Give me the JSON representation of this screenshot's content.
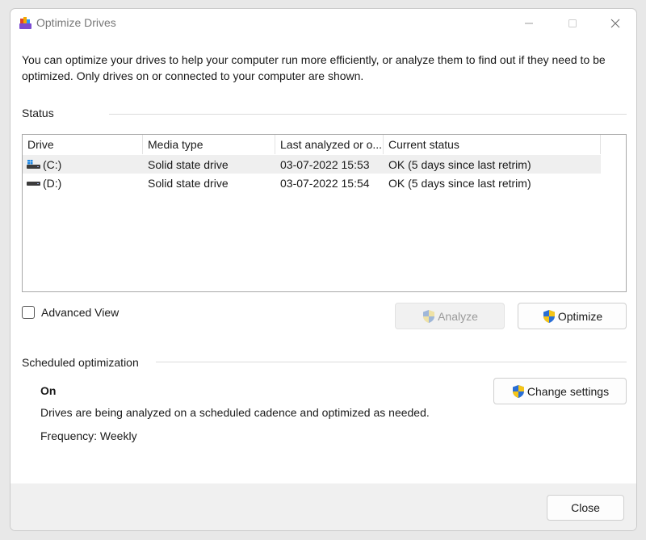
{
  "window": {
    "title": "Optimize Drives",
    "controls": {
      "minimize_icon": "minimize-icon",
      "maximize_icon": "maximize-icon",
      "close_icon": "close-icon"
    }
  },
  "intro": "You can optimize your drives to help your computer run more efficiently, or analyze them to find out if they need to be optimized. Only drives on or connected to your computer are shown.",
  "status": {
    "label": "Status",
    "columns": [
      "Drive",
      "Media type",
      "Last analyzed or o...",
      "Current status"
    ],
    "drives": [
      {
        "icon": "windows-drive-icon",
        "name": "(C:)",
        "media": "Solid state drive",
        "last": "03-07-2022 15:53",
        "status": "OK (5 days since last retrim)",
        "selected": true
      },
      {
        "icon": "drive-icon",
        "name": "(D:)",
        "media": "Solid state drive",
        "last": "03-07-2022 15:54",
        "status": "OK (5 days since last retrim)",
        "selected": false
      }
    ]
  },
  "advanced_view": {
    "label": "Advanced View",
    "checked": false
  },
  "buttons": {
    "analyze": "Analyze",
    "optimize": "Optimize",
    "change_settings": "Change settings",
    "close": "Close"
  },
  "scheduled": {
    "label": "Scheduled optimization",
    "state": "On",
    "description": "Drives are being analyzed on a scheduled cadence and optimized as needed.",
    "frequency": "Frequency: Weekly"
  },
  "colors": {
    "shield_blue": "#2a6fd6",
    "shield_yellow": "#f5c518"
  }
}
